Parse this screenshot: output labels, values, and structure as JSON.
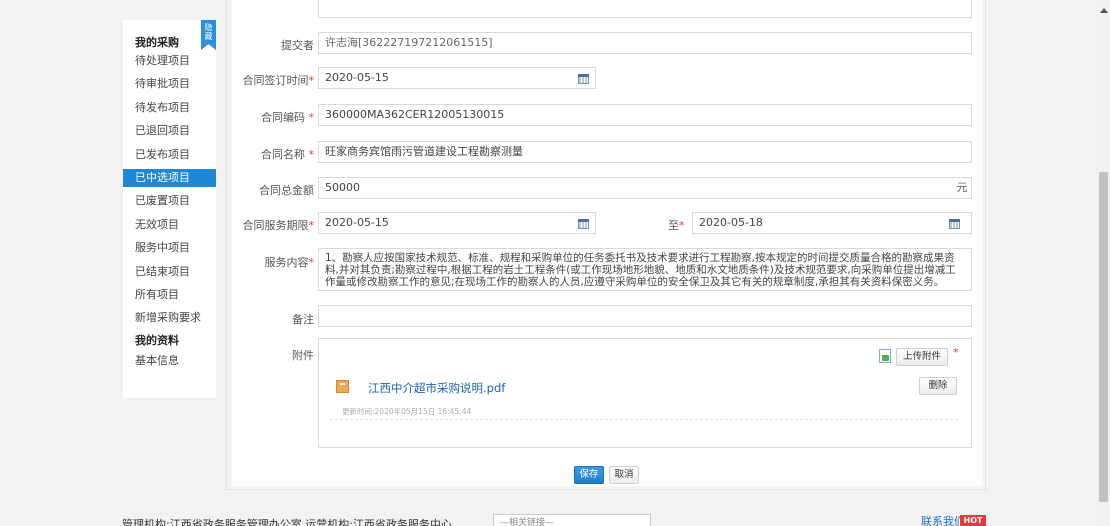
{
  "sidebar": {
    "toggle_label": "隐藏",
    "group1_title": "我的采购",
    "items": [
      {
        "label": "待处理项目"
      },
      {
        "label": "待审批项目"
      },
      {
        "label": "待发布项目"
      },
      {
        "label": "已退回项目"
      },
      {
        "label": "已发布项目"
      },
      {
        "label": "已中选项目",
        "active": true
      },
      {
        "label": "已废置项目"
      },
      {
        "label": "无效项目"
      },
      {
        "label": "服务中项目"
      },
      {
        "label": "已结束项目"
      },
      {
        "label": "所有项目"
      },
      {
        "label": "新增采购要求"
      }
    ],
    "group2_title": "我的资料",
    "group2_items": [
      {
        "label": "基本信息"
      }
    ]
  },
  "form": {
    "submitter": {
      "label": "提交者",
      "value": "许志海[362227197212061515]"
    },
    "sign_date": {
      "label": "合同签订时间",
      "required": "*",
      "value": "2020-05-15"
    },
    "contract_no": {
      "label": "合同编码",
      "required": "*",
      "value": "360000MA362CER12005130015"
    },
    "contract_name": {
      "label": "合同名称",
      "required": "*",
      "value": "旺家商务宾馆雨污管道建设工程勘察测量"
    },
    "amount": {
      "label": "合同总金额",
      "value": "50000",
      "unit": "元"
    },
    "service_period": {
      "label": "合同服务期限",
      "required": "*",
      "start": "2020-05-15",
      "to_label": "至",
      "to_required": "*",
      "end": "2020-05-18"
    },
    "service_content": {
      "label": "服务内容",
      "required": "*",
      "value": "1、勘察人应按国家技术规范、标准、规程和采购单位的任务委托书及技术要求进行工程勘察,按本规定的时间提交质量合格的勘察成果资料,并对其负责;勘察过程中,根据工程的岩土工程条件(或工作现场地形地貌、地质和水文地质条件)及技术规范要求,向采购单位提出增减工作量或修改勘察工作的意见;在现场工作的勘察人的人员,应遵守采购单位的安全保卫及其它有关的规章制度,承担其有关资料保密义务。"
    },
    "remark": {
      "label": "备注",
      "value": ""
    },
    "attachment": {
      "label": "附件",
      "upload_button": "上传附件",
      "required": "*",
      "file_name": "江西中介超市采购说明.pdf",
      "delete_button": "删除",
      "update_time": "更新时间:2020年05月15日 16:45:44"
    }
  },
  "actions": {
    "save": "保存",
    "cancel": "取消"
  },
  "footer": {
    "text": "管理机构:江西省政务服务管理办公室 运营机构:江西省政务服务中心 ",
    "select_value": "—相关链接—",
    "contact": "联系我们",
    "hot": "HOT"
  }
}
